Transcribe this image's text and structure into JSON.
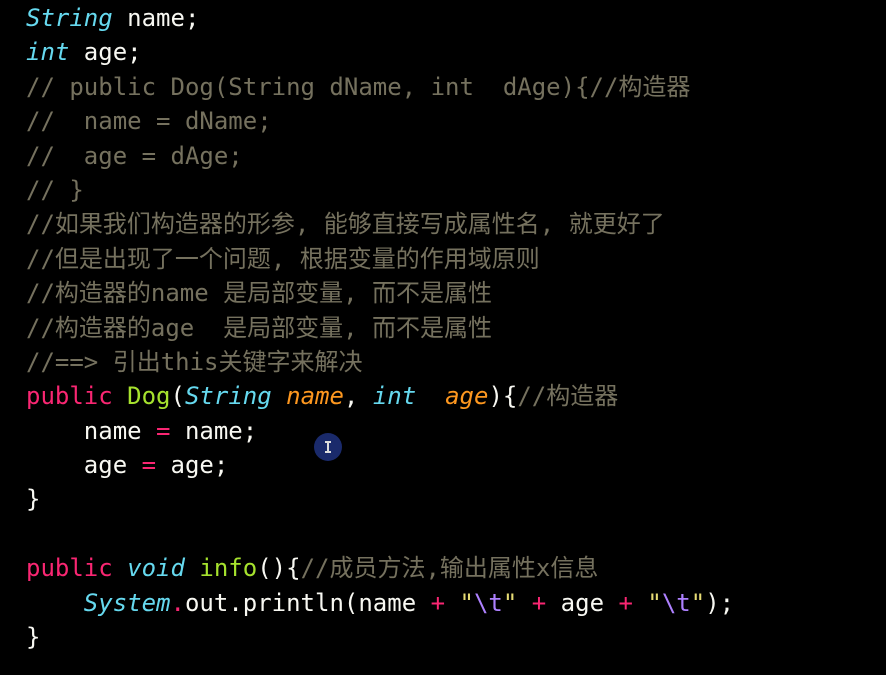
{
  "colors": {
    "background": "#000000",
    "plain": "#f8f8f2",
    "comment": "#75715e",
    "keyword": "#f92672",
    "type": "#66d9ef",
    "function": "#a6e22e",
    "parameter": "#fd971f",
    "string": "#e6db74",
    "escape": "#ae81ff"
  },
  "cursor": {
    "icon": "text-cursor-icon"
  },
  "code": {
    "l1": {
      "type": "String",
      "rest": " name;"
    },
    "l2": {
      "type": "int",
      "rest": " age;"
    },
    "l3": {
      "comment": "// public Dog(String dName, int  dAge){//构造器"
    },
    "l4": {
      "comment": "//  name = dName;"
    },
    "l5": {
      "comment": "//  age = dAge;"
    },
    "l6": {
      "comment": "// }"
    },
    "l7": {
      "comment": "//如果我们构造器的形参, 能够直接写成属性名, 就更好了"
    },
    "l8": {
      "comment": "//但是出现了一个问题, 根据变量的作用域原则"
    },
    "l9": {
      "comment": "//构造器的name 是局部变量, 而不是属性"
    },
    "l10": {
      "comment": "//构造器的age  是局部变量, 而不是属性"
    },
    "l11": {
      "comment": "//==> 引出this关键字来解决"
    },
    "l12": {
      "kw": "public",
      "sp1": " ",
      "fn": "Dog",
      "open": "(",
      "type1": "String",
      "sp2": " ",
      "param1": "name",
      "comma": ", ",
      "type2": "int",
      "sp3": "  ",
      "param2": "age",
      "close": "){",
      "comment": "//构造器"
    },
    "l13": {
      "indent": "    ",
      "lhs": "name",
      "sp1": " ",
      "op": "=",
      "rhs": " name;"
    },
    "l14": {
      "indent": "    ",
      "lhs": "age",
      "sp1": " ",
      "op": "=",
      "rhs": " age;"
    },
    "l15": {
      "text": "}"
    },
    "l16": {
      "text": ""
    },
    "l17": {
      "kw": "public",
      "sp1": " ",
      "type": "void",
      "sp2": " ",
      "fn": "info",
      "paren": "(){",
      "comment": "//成员方法,输出属性x信息"
    },
    "l18": {
      "indent": "    ",
      "cls": "System",
      "dot": ".",
      "field": "out",
      "call": ".println(name ",
      "op1": "+",
      "sp1": " ",
      "q1": "\"",
      "esc1": "\\t",
      "q2": "\"",
      "sp2": " ",
      "op2": "+",
      "mid": " age ",
      "op3": "+",
      "sp3": " ",
      "q3": "\"",
      "esc2": "\\t",
      "q4": "\"",
      "end": ");"
    },
    "l19": {
      "text": "}"
    }
  }
}
